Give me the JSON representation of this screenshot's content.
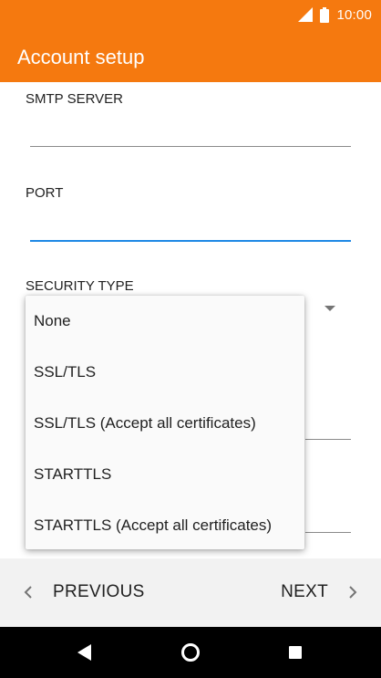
{
  "status_bar": {
    "time": "10:00",
    "icons": [
      "signal-icon",
      "battery-icon"
    ]
  },
  "app_bar": {
    "title": "Account setup",
    "color": "#f5790f"
  },
  "form": {
    "smtp_server": {
      "label": "SMTP SERVER",
      "value": ""
    },
    "port": {
      "label": "PORT",
      "value": ""
    },
    "security_type": {
      "label": "SECURITY TYPE"
    }
  },
  "security_popup": {
    "options": [
      "None",
      "SSL/TLS",
      "SSL/TLS (Accept all certificates)",
      "STARTTLS",
      "STARTTLS (Accept all certificates)"
    ]
  },
  "wizard_nav": {
    "previous_label": "PREVIOUS",
    "next_label": "NEXT"
  },
  "colors": {
    "accent": "#f5790f",
    "focus": "#1e88e5"
  }
}
